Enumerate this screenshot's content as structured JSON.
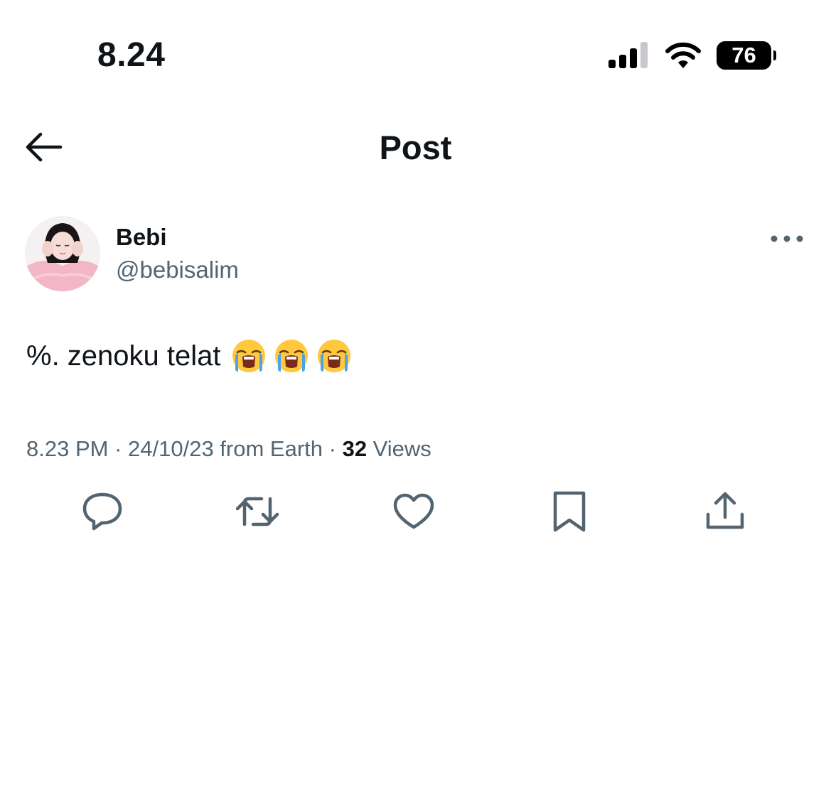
{
  "status_bar": {
    "time": "8.24",
    "battery_level": "76",
    "icons": [
      "signal-icon",
      "wifi-icon",
      "battery-icon"
    ]
  },
  "header": {
    "title": "Post",
    "back_icon": "back-arrow-icon"
  },
  "author": {
    "name": "Bebi",
    "handle": "@bebisalim"
  },
  "post": {
    "text": "%. zenoku telat",
    "emojis": [
      "loudly-crying-face",
      "loudly-crying-face",
      "loudly-crying-face"
    ],
    "time": "8.23 PM",
    "separator": " · ",
    "date": "24/10/23",
    "source": " from Earth",
    "views_count": "32",
    "views_label": " Views"
  },
  "actions": [
    "reply-icon",
    "repost-icon",
    "like-icon",
    "bookmark-icon",
    "share-icon"
  ],
  "colors": {
    "text_primary": "#0f1419",
    "text_secondary": "#536471",
    "background": "#ffffff"
  }
}
